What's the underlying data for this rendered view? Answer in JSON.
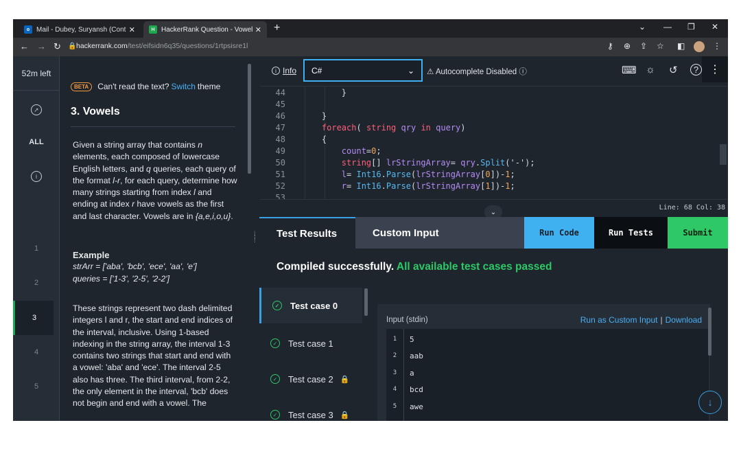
{
  "browser": {
    "tabs": [
      {
        "label": "Mail - Dubey, Suryansh (Contract",
        "favicon": "outlook-icon"
      },
      {
        "label": "HackerRank Question - Vowels",
        "favicon": "hackerrank-icon"
      }
    ],
    "url_domain": "hackerrank.com",
    "url_path": "/test/eifsidn6q35/questions/1rtpsisre1l"
  },
  "rail": {
    "timer": "52m left",
    "items": [
      "ALL",
      "1",
      "2",
      "3",
      "4",
      "5"
    ],
    "active": "3"
  },
  "problem": {
    "beta_badge": "BETA",
    "theme_prefix": "Can't read the text?",
    "theme_link": "Switch",
    "theme_suffix": "theme",
    "title": "3. Vowels",
    "desc_1": "Given a string array that contains ",
    "desc_n": "n",
    "desc_2": " elements, each composed of lowercase English letters, and ",
    "desc_q": "q",
    "desc_3": " queries, each query of the format ",
    "desc_lr": "l-r",
    "desc_4": ", for each query, determine how many strings starting from index ",
    "desc_l": "l",
    "desc_5": " and ending at index ",
    "desc_r": "r",
    "desc_6": " have vowels as the first and last character. Vowels are in ",
    "desc_vowels": "{a,e,i,o,u}",
    "desc_7": ".",
    "example_heading": "Example",
    "example_arr": "strArr = ['aba', 'bcb', 'ece', 'aa', 'e']",
    "example_queries": "queries = ['1-3', '2-5', '2-2']",
    "para_2": "These strings represent two dash delimited integers l and r, the start and end indices of the interval, inclusive. Using 1-based indexing in the string array, the interval 1-3 contains two strings that start and end with a vowel: 'aba' and 'ece'. The interval 2-5 also has three. The third interval, from 2-2, the only element in the interval, 'bcb' does not begin and end with a vowel. The"
  },
  "toolbar": {
    "info_label": "Info",
    "language": "C#",
    "autocomplete": "Autocomplete Disabled"
  },
  "editor": {
    "lines": [
      {
        "n": "44",
        "t": "        }"
      },
      {
        "n": "45",
        "t": ""
      },
      {
        "n": "46",
        "t": "    }"
      },
      {
        "n": "47",
        "t": "    foreach( string qry in query)"
      },
      {
        "n": "48",
        "t": "    {"
      },
      {
        "n": "49",
        "t": "        count=0;"
      },
      {
        "n": "50",
        "t": "        string[] lrStringArray= qry.Split('-');"
      },
      {
        "n": "51",
        "t": "        l= Int16.Parse(lrStringArray[0])-1;"
      },
      {
        "n": "52",
        "t": "        r= Int16.Parse(lrStringArray[1])-1;"
      },
      {
        "n": "53",
        "t": ""
      }
    ],
    "status": "Line: 68 Col: 38"
  },
  "results": {
    "tab_results": "Test Results",
    "tab_custom": "Custom Input",
    "run_code": "Run Code",
    "run_tests": "Run Tests",
    "submit": "Submit",
    "compiled": "Compiled successfully.",
    "passed": "All available test cases passed",
    "testcases": [
      "Test case 0",
      "Test case 1",
      "Test case 2",
      "Test case 3"
    ],
    "input_label": "Input (stdin)",
    "run_custom": "Run as Custom Input",
    "download": "Download",
    "input_lines": [
      {
        "n": "1",
        "v": "5"
      },
      {
        "n": "2",
        "v": "aab"
      },
      {
        "n": "3",
        "v": "a"
      },
      {
        "n": "4",
        "v": "bcd"
      },
      {
        "n": "5",
        "v": "awe"
      }
    ]
  },
  "colors": {
    "accent_blue": "#3fb0f0",
    "success_green": "#2ec866",
    "background": "#1e252d"
  }
}
